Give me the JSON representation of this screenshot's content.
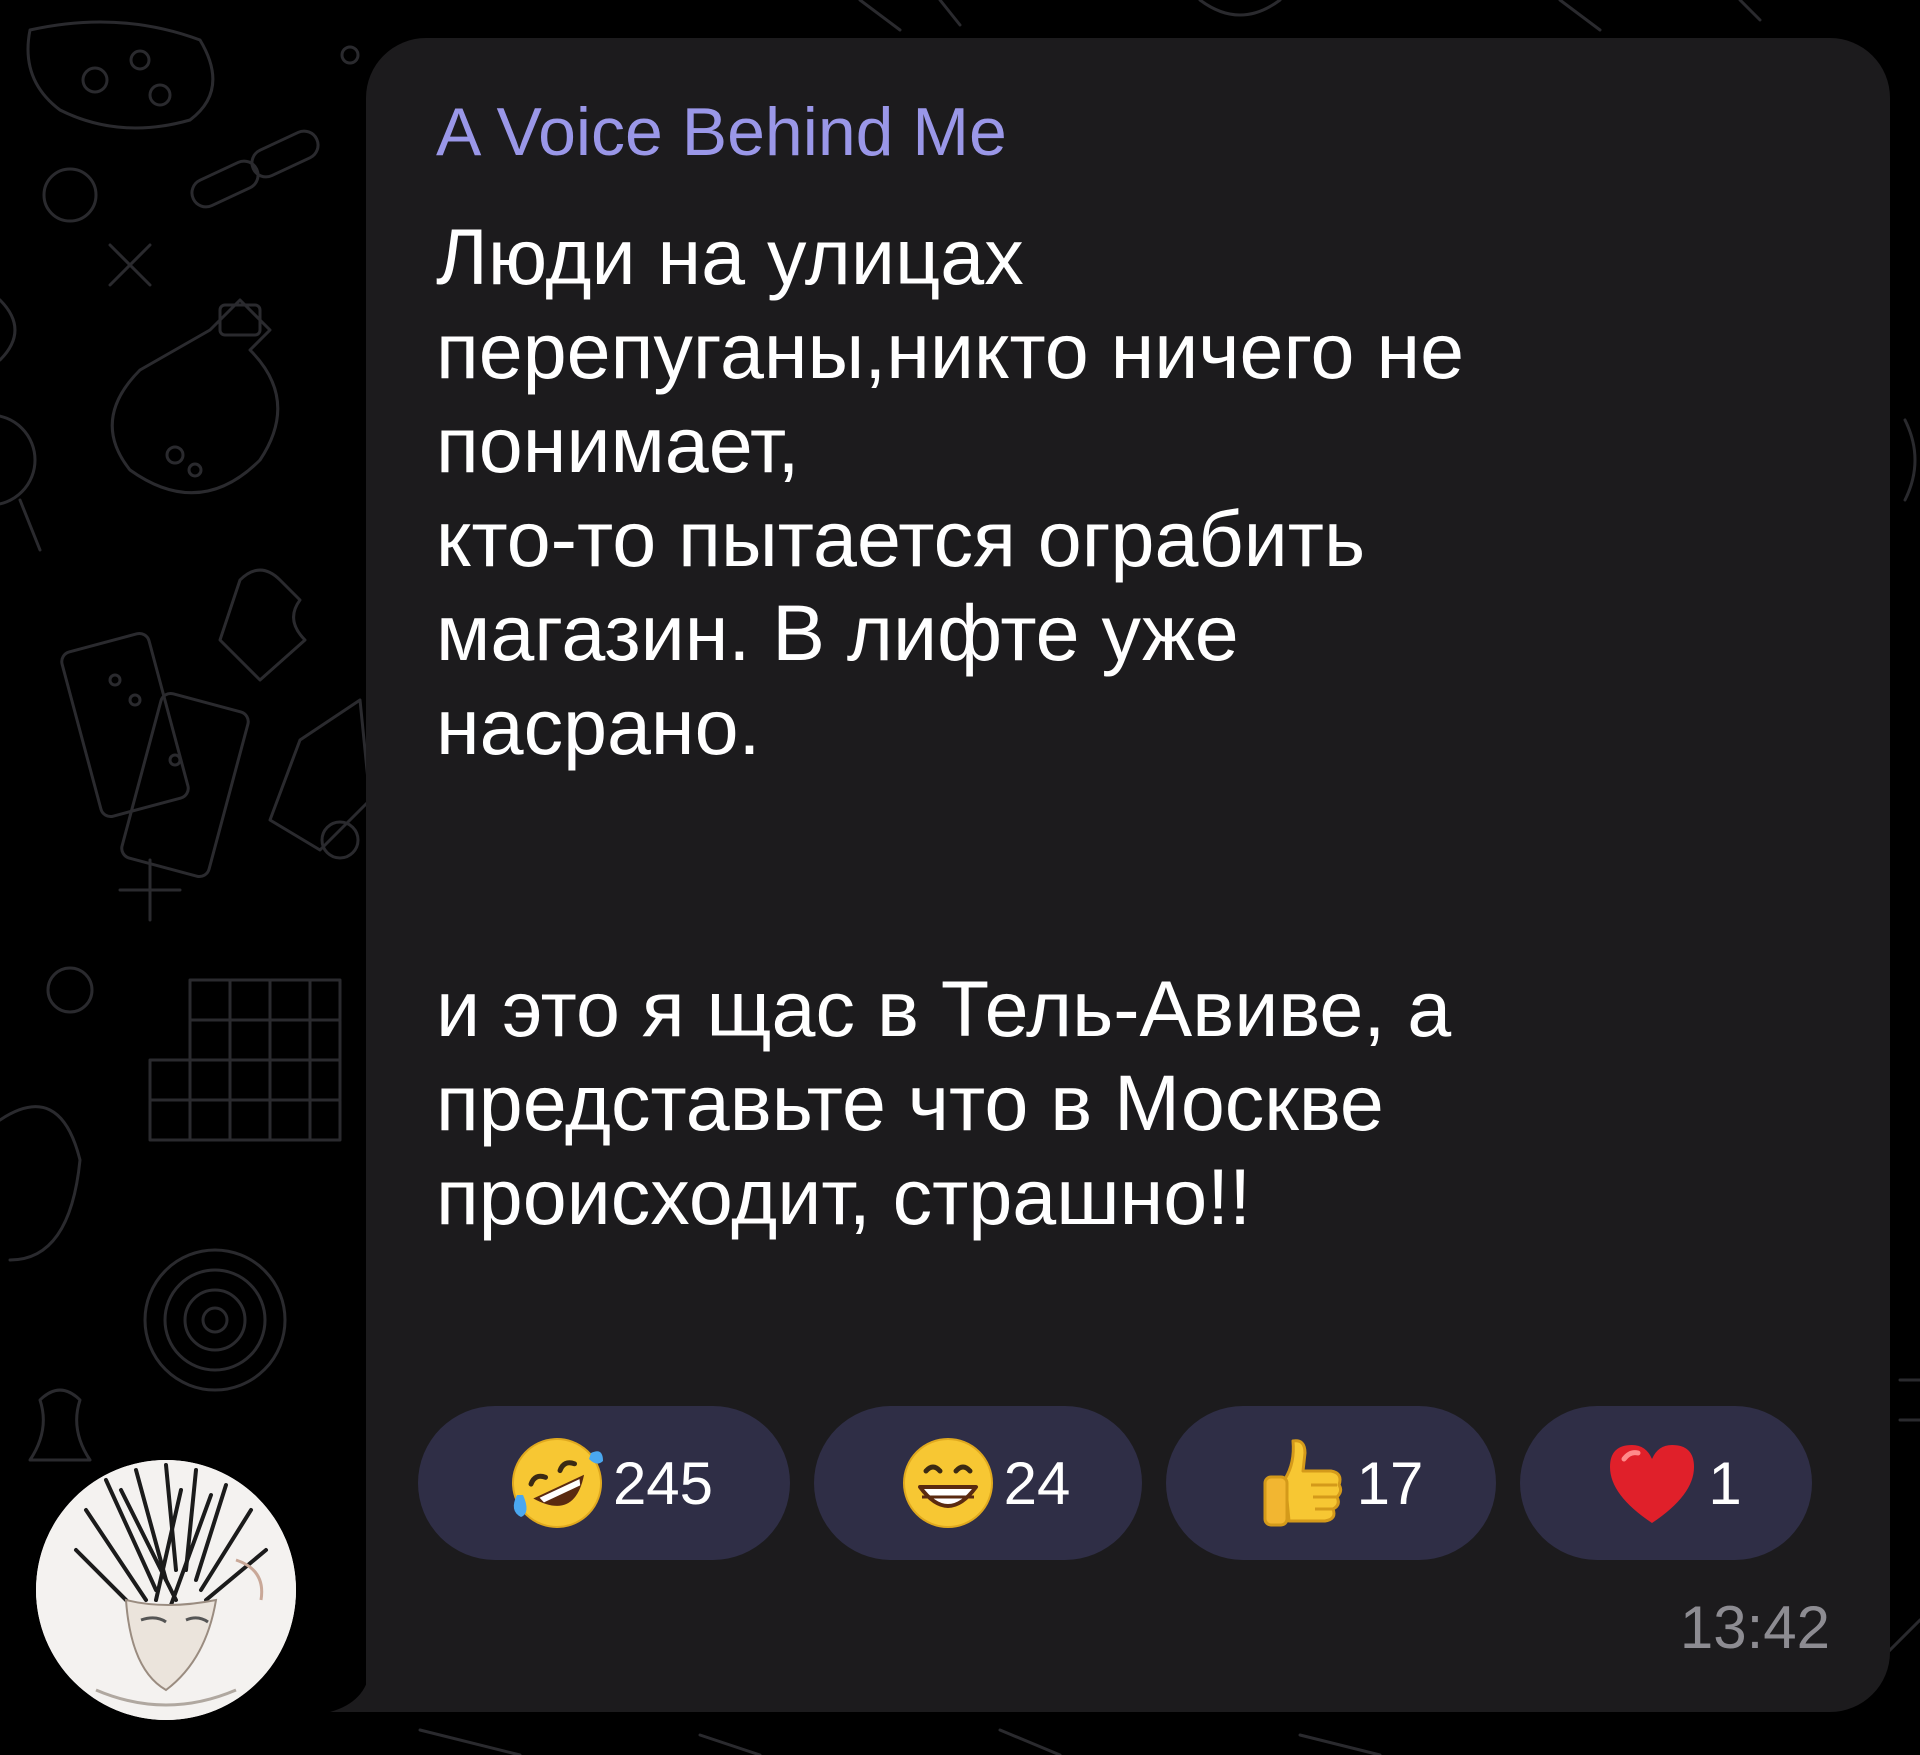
{
  "message": {
    "sender_name": "A Voice Behind Me",
    "text": "Люди на улицах\nперепуганы,никто ничего не\nпонимает,\nкто-то пытается ограбить\nмагазин. В лифте уже\nнасрано.\n\n\nи это я щас в Тель-Авиве, а\nпредставьте что в Москве\nпроисходит, страшно!!",
    "time": "13:42"
  },
  "reactions": [
    {
      "emoji": "rolling-on-floor-laughing-emoji",
      "count": "245"
    },
    {
      "emoji": "grinning-face-emoji",
      "count": "24"
    },
    {
      "emoji": "thumbs-up-emoji",
      "count": "17"
    },
    {
      "emoji": "red-heart-emoji",
      "count": "1"
    }
  ],
  "colors": {
    "background": "#000000",
    "bubble": "#1c1b1d",
    "sender_name": "#9a97e8",
    "text": "#ffffff",
    "reaction_pill": "#2f2e46",
    "timestamp": "#8d8c92"
  }
}
